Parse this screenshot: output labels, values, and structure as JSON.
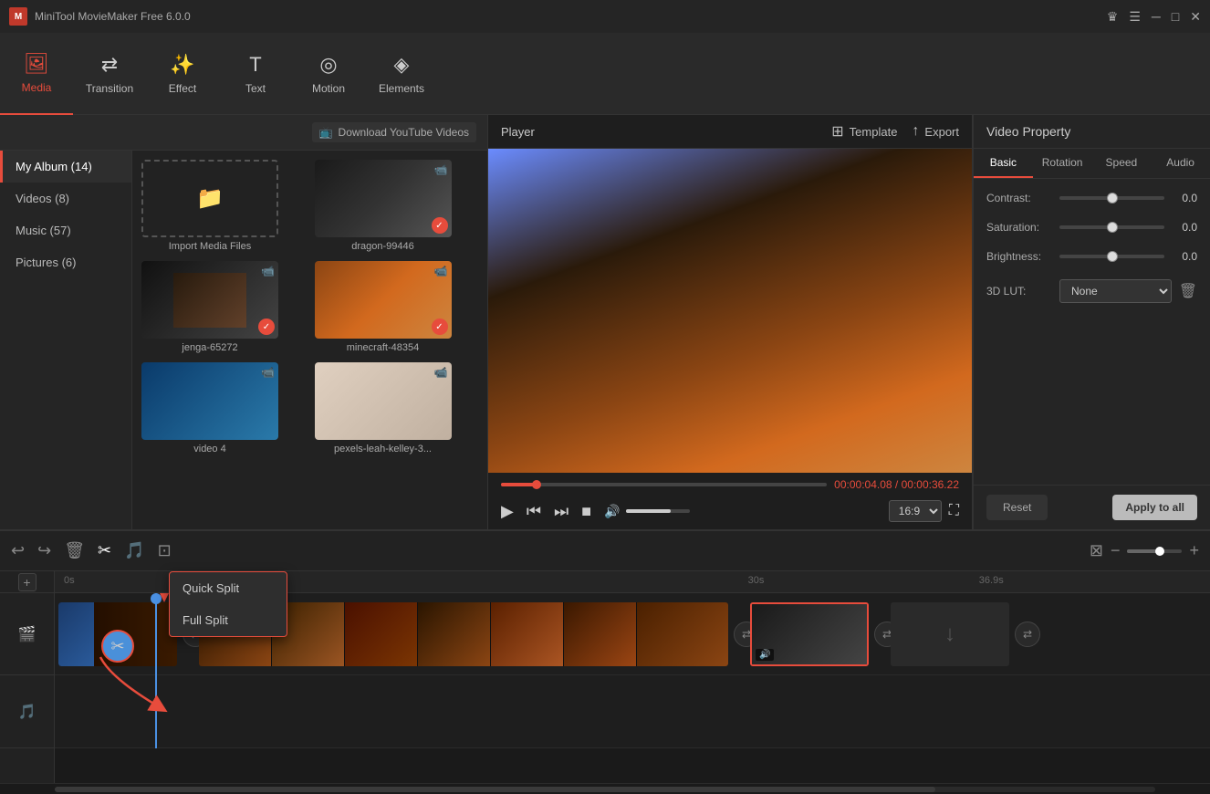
{
  "app": {
    "title": "MiniTool MovieMaker Free 6.0.0"
  },
  "titlebar": {
    "title": "MiniTool MovieMaker Free 6.0.0",
    "controls": [
      "crown-icon",
      "menu-icon",
      "minimize-icon",
      "maximize-icon",
      "close-icon"
    ]
  },
  "topnav": {
    "items": [
      {
        "id": "media",
        "label": "Media",
        "active": true
      },
      {
        "id": "transition",
        "label": "Transition",
        "active": false
      },
      {
        "id": "effect",
        "label": "Effect",
        "active": false
      },
      {
        "id": "text",
        "label": "Text",
        "active": false
      },
      {
        "id": "motion",
        "label": "Motion",
        "active": false
      },
      {
        "id": "elements",
        "label": "Elements",
        "active": false
      }
    ]
  },
  "sidebar": {
    "items": [
      {
        "label": "My Album (14)",
        "active": true
      },
      {
        "label": "Videos (8)",
        "active": false
      },
      {
        "label": "Music (57)",
        "active": false
      },
      {
        "label": "Pictures (6)",
        "active": false
      }
    ],
    "download_btn": "Download YouTube Videos"
  },
  "media_grid": {
    "items": [
      {
        "id": "import",
        "label": "Import Media Files",
        "is_import": true
      },
      {
        "id": "dragon",
        "label": "dragon-99446",
        "has_check": true,
        "has_cam": true
      },
      {
        "id": "jenga",
        "label": "jenga-65272",
        "has_check": true,
        "has_cam": true
      },
      {
        "id": "minecraft",
        "label": "minecraft-48354",
        "has_check": true,
        "has_cam": true
      },
      {
        "id": "video4",
        "label": "video 4",
        "has_check": false,
        "has_cam": true
      },
      {
        "id": "pexels",
        "label": "pexels-leah-kelley-3...",
        "has_check": false,
        "has_cam": false
      }
    ]
  },
  "player": {
    "title": "Player",
    "template_btn": "Template",
    "export_btn": "Export",
    "current_time": "00:00:04.08",
    "total_time": "00:00:36.22",
    "aspect_ratio": "16:9",
    "volume": 70,
    "progress_pct": 11
  },
  "video_property": {
    "title": "Video Property",
    "tabs": [
      "Basic",
      "Rotation",
      "Speed",
      "Audio"
    ],
    "active_tab": "Basic",
    "contrast": {
      "label": "Contrast:",
      "value": "0.0"
    },
    "saturation": {
      "label": "Saturation:",
      "value": "0.0"
    },
    "brightness": {
      "label": "Brightness:",
      "value": "0.0"
    },
    "lut": {
      "label": "3D LUT:",
      "value": "None"
    },
    "reset_btn": "Reset",
    "apply_all_btn": "Apply to all"
  },
  "timeline": {
    "toolbar_btns": [
      "undo",
      "redo",
      "delete",
      "cut",
      "audio",
      "crop"
    ],
    "ruler_marks": [
      "0s",
      "30s",
      "36.9s"
    ],
    "split_dropdown": {
      "visible": true,
      "items": [
        "Quick Split",
        "Full Split"
      ]
    },
    "tracks": [
      {
        "type": "video",
        "icon": "🎬"
      },
      {
        "type": "audio",
        "icon": "🎵"
      }
    ]
  }
}
